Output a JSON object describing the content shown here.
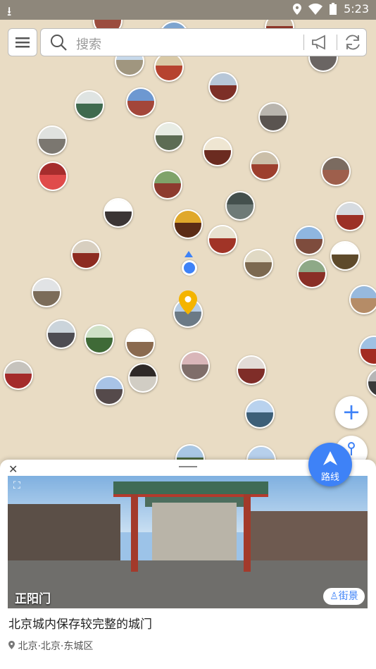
{
  "status_bar": {
    "time": "5:23",
    "download_icon": "download-icon",
    "location_icon": "location-icon",
    "wifi_icon": "wifi-icon",
    "battery_icon": "battery-icon"
  },
  "search": {
    "placeholder": "搜索",
    "menu_icon": "menu-icon",
    "search_icon": "search-icon",
    "megaphone_icon": "megaphone-icon",
    "refresh_icon": "refresh-icon"
  },
  "map": {
    "zoom_icon": "plus-icon",
    "path_icon": "route-path-icon"
  },
  "route_button": {
    "label": "路线"
  },
  "place_card": {
    "close_icon": "close-icon",
    "name": "正阳门",
    "street_view_label": "街景",
    "description": "北京城内保存较完整的城门",
    "address": "北京·北京·东城区"
  },
  "colors": {
    "accent": "#3e82f7",
    "map_bg": "#e9dcc4",
    "pin": "#f4b400"
  }
}
